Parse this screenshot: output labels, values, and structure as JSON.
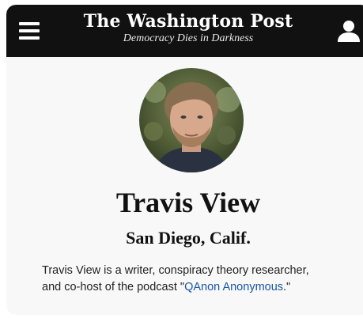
{
  "header": {
    "logo": "The Washington Post",
    "tagline": "Democracy Dies in Darkness",
    "menu_icon": "hamburger-menu-icon",
    "user_icon": "user-account-icon",
    "background": "#111111"
  },
  "author": {
    "name": "Travis View",
    "location": "San Diego, Calif.",
    "bio_line1": "Travis View is a writer, conspiracy theory researcher,",
    "bio_line2_prefix": "and co-host of the podcast \"",
    "bio_link": "QAnon Anonymous",
    "bio_line2_suffix": ".\"",
    "link_color": "#1955a5"
  }
}
